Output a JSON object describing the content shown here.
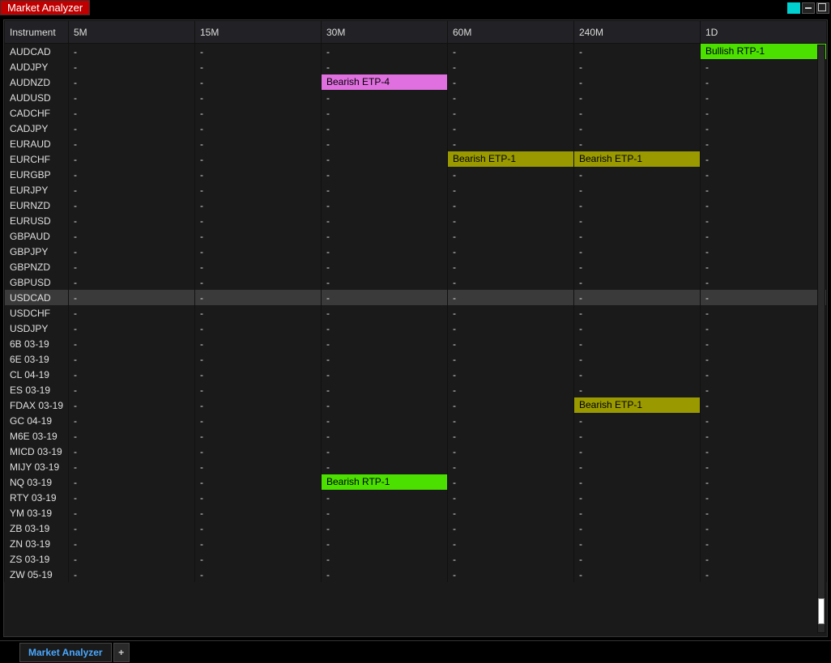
{
  "window": {
    "title": "Market Analyzer"
  },
  "tabs": {
    "active_label": "Market Analyzer",
    "add_label": "+"
  },
  "columns": [
    "Instrument",
    "5M",
    "15M",
    "30M",
    "60M",
    "240M",
    "1D"
  ],
  "rows": [
    {
      "instrument": "AUDCAD",
      "cells": [
        "-",
        "-",
        "-",
        "-",
        "-",
        {
          "text": "Bullish RTP-1",
          "style": "lime"
        }
      ]
    },
    {
      "instrument": "AUDJPY",
      "cells": [
        "-",
        "-",
        "-",
        "-",
        "-",
        "-"
      ]
    },
    {
      "instrument": "AUDNZD",
      "cells": [
        "-",
        "-",
        {
          "text": "Bearish ETP-4",
          "style": "magenta"
        },
        "-",
        "-",
        "-"
      ]
    },
    {
      "instrument": "AUDUSD",
      "cells": [
        "-",
        "-",
        "-",
        "-",
        "-",
        "-"
      ]
    },
    {
      "instrument": "CADCHF",
      "cells": [
        "-",
        "-",
        "-",
        "-",
        "-",
        "-"
      ]
    },
    {
      "instrument": "CADJPY",
      "cells": [
        "-",
        "-",
        "-",
        "-",
        "-",
        "-"
      ]
    },
    {
      "instrument": "EURAUD",
      "cells": [
        "-",
        "-",
        "-",
        "-",
        "-",
        "-"
      ]
    },
    {
      "instrument": "EURCHF",
      "cells": [
        "-",
        "-",
        "-",
        {
          "text": "Bearish ETP-1",
          "style": "olive"
        },
        {
          "text": "Bearish ETP-1",
          "style": "olive"
        },
        "-"
      ]
    },
    {
      "instrument": "EURGBP",
      "cells": [
        "-",
        "-",
        "-",
        "-",
        "-",
        "-"
      ]
    },
    {
      "instrument": "EURJPY",
      "cells": [
        "-",
        "-",
        "-",
        "-",
        "-",
        "-"
      ]
    },
    {
      "instrument": "EURNZD",
      "cells": [
        "-",
        "-",
        "-",
        "-",
        "-",
        "-"
      ]
    },
    {
      "instrument": "EURUSD",
      "cells": [
        "-",
        "-",
        "-",
        "-",
        "-",
        "-"
      ]
    },
    {
      "instrument": "GBPAUD",
      "cells": [
        "-",
        "-",
        "-",
        "-",
        "-",
        "-"
      ]
    },
    {
      "instrument": "GBPJPY",
      "cells": [
        "-",
        "-",
        "-",
        "-",
        "-",
        "-"
      ]
    },
    {
      "instrument": "GBPNZD",
      "cells": [
        "-",
        "-",
        "-",
        "-",
        "-",
        "-"
      ]
    },
    {
      "instrument": "GBPUSD",
      "cells": [
        "-",
        "-",
        "-",
        "-",
        "-",
        "-"
      ]
    },
    {
      "instrument": "USDCAD",
      "cells": [
        "-",
        "-",
        "-",
        "-",
        "-",
        "-"
      ],
      "highlight": true
    },
    {
      "instrument": "USDCHF",
      "cells": [
        "-",
        "-",
        "-",
        "-",
        "-",
        "-"
      ]
    },
    {
      "instrument": "USDJPY",
      "cells": [
        "-",
        "-",
        "-",
        "-",
        "-",
        "-"
      ]
    },
    {
      "instrument": "6B 03-19",
      "cells": [
        "-",
        "-",
        "-",
        "-",
        "-",
        "-"
      ]
    },
    {
      "instrument": "6E 03-19",
      "cells": [
        "-",
        "-",
        "-",
        "-",
        "-",
        "-"
      ]
    },
    {
      "instrument": "CL 04-19",
      "cells": [
        "-",
        "-",
        "-",
        "-",
        "-",
        "-"
      ]
    },
    {
      "instrument": "ES 03-19",
      "cells": [
        "-",
        "-",
        "-",
        "-",
        "-",
        "-"
      ]
    },
    {
      "instrument": "FDAX 03-19",
      "cells": [
        "-",
        "-",
        "-",
        "-",
        {
          "text": "Bearish ETP-1",
          "style": "olive"
        },
        "-"
      ]
    },
    {
      "instrument": "GC 04-19",
      "cells": [
        "-",
        "-",
        "-",
        "-",
        "-",
        "-"
      ]
    },
    {
      "instrument": "M6E 03-19",
      "cells": [
        "-",
        "-",
        "-",
        "-",
        "-",
        "-"
      ]
    },
    {
      "instrument": "MICD 03-19",
      "cells": [
        "-",
        "-",
        "-",
        "-",
        "-",
        "-"
      ]
    },
    {
      "instrument": "MIJY 03-19",
      "cells": [
        "-",
        "-",
        "-",
        "-",
        "-",
        "-"
      ]
    },
    {
      "instrument": "NQ 03-19",
      "cells": [
        "-",
        "-",
        {
          "text": "Bearish RTP-1",
          "style": "lime"
        },
        "-",
        "-",
        "-"
      ]
    },
    {
      "instrument": "RTY 03-19",
      "cells": [
        "-",
        "-",
        "-",
        "-",
        "-",
        "-"
      ]
    },
    {
      "instrument": "YM 03-19",
      "cells": [
        "-",
        "-",
        "-",
        "-",
        "-",
        "-"
      ]
    },
    {
      "instrument": "ZB 03-19",
      "cells": [
        "-",
        "-",
        "-",
        "-",
        "-",
        "-"
      ]
    },
    {
      "instrument": "ZN 03-19",
      "cells": [
        "-",
        "-",
        "-",
        "-",
        "-",
        "-"
      ]
    },
    {
      "instrument": "ZS 03-19",
      "cells": [
        "-",
        "-",
        "-",
        "-",
        "-",
        "-"
      ]
    },
    {
      "instrument": "ZW 05-19",
      "cells": [
        "-",
        "-",
        "-",
        "-",
        "-",
        "-"
      ]
    }
  ]
}
